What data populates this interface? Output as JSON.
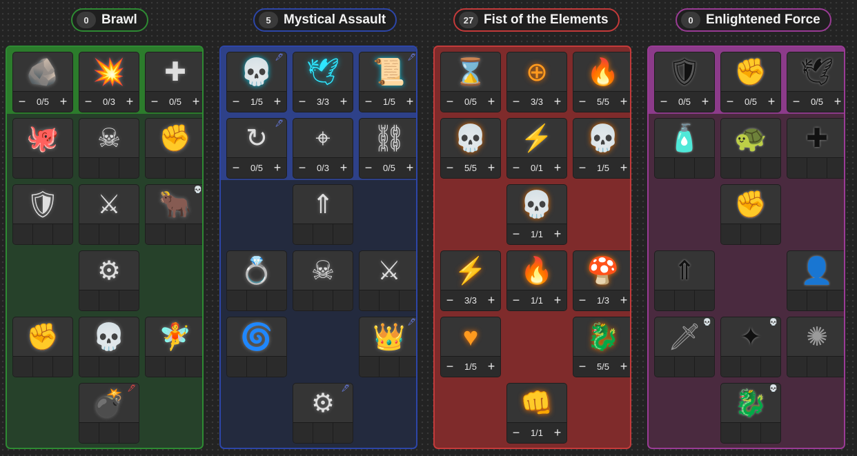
{
  "colors": {
    "brawl": "#2e8b33",
    "mystical": "#2d46a8",
    "fist": "#c43a3a",
    "enlightened": "#9a3b95"
  },
  "trees": [
    {
      "name": "Brawl",
      "points": "0",
      "skills": [
        {
          "icon": "marked-rock-icon",
          "glyph": "🪨",
          "style": "grey",
          "count": "0/5"
        },
        {
          "icon": "exploding-cannon-icon",
          "glyph": "💥",
          "style": "grey",
          "count": "0/3"
        },
        {
          "icon": "plus-crest-icon",
          "glyph": "✚",
          "style": "grey",
          "count": "0/5"
        },
        {
          "icon": "octopus-icon",
          "glyph": "🐙",
          "style": "grey"
        },
        {
          "icon": "cross-skull-icon",
          "glyph": "☠",
          "style": "grey"
        },
        {
          "icon": "swirl-fist-icon",
          "glyph": "✊",
          "style": "grey"
        },
        {
          "icon": "bandaged-shield-icon",
          "glyph": "🛡",
          "style": "grey"
        },
        {
          "icon": "scythe-burst-icon",
          "glyph": "⚔",
          "style": "grey"
        },
        {
          "icon": "horned-beast-icon",
          "glyph": "🐂",
          "style": "grey",
          "badge": "skull"
        },
        {
          "icon": "spiked-drill-icon",
          "glyph": "⚙",
          "style": "grey"
        },
        {
          "icon": "fist-burst-icon",
          "glyph": "✊",
          "style": "grey"
        },
        {
          "icon": "bone-skull-icon",
          "glyph": "💀",
          "style": "grey"
        },
        {
          "icon": "winged-fairy-icon",
          "glyph": "🧚",
          "style": "grey"
        },
        {
          "icon": "bomb-icon",
          "glyph": "💣",
          "style": "grey",
          "badge": "red-feather"
        }
      ]
    },
    {
      "name": "Mystical Assault",
      "points": "5",
      "skills": [
        {
          "icon": "triple-skull-icon",
          "glyph": "💀",
          "style": "cyan",
          "count": "1/5",
          "badge": "feather"
        },
        {
          "icon": "winged-gauntlet-icon",
          "glyph": "🕊",
          "style": "cyan",
          "count": "3/3"
        },
        {
          "icon": "skull-scroll-icon",
          "glyph": "📜",
          "style": "cyan",
          "count": "1/5",
          "badge": "feather"
        },
        {
          "icon": "arrow-fist-icon",
          "glyph": "↻",
          "style": "grey",
          "count": "0/5",
          "badge": "feather"
        },
        {
          "icon": "crosshair-icon",
          "glyph": "⌖",
          "style": "grey",
          "count": "0/3"
        },
        {
          "icon": "chain-ring-icon",
          "glyph": "⛓",
          "style": "grey",
          "count": "0/5"
        },
        {
          "icon": "rising-arrow-icon",
          "glyph": "⇑",
          "style": "grey"
        },
        {
          "icon": "ring-toss-icon",
          "glyph": "💍",
          "style": "grey"
        },
        {
          "icon": "skull-arrow-icon",
          "glyph": "☠",
          "style": "grey"
        },
        {
          "icon": "crossed-fists-icon",
          "glyph": "⚔",
          "style": "grey"
        },
        {
          "icon": "whirlwind-icon",
          "glyph": "🌀",
          "style": "grey"
        },
        {
          "icon": "crowned-skull-icon",
          "glyph": "👑",
          "style": "grey",
          "badge": "feather"
        },
        {
          "icon": "spinning-saw-icon",
          "glyph": "⚙",
          "style": "grey",
          "badge": "feather"
        }
      ]
    },
    {
      "name": "Fist of the Elements",
      "points": "27",
      "skills": [
        {
          "icon": "hourglass-icon",
          "glyph": "⌛",
          "style": "grey",
          "count": "0/5"
        },
        {
          "icon": "crosshair-fist-icon",
          "glyph": "⊕",
          "style": "orange",
          "count": "3/3"
        },
        {
          "icon": "flame-book-icon",
          "glyph": "🔥",
          "style": "orange",
          "count": "5/5"
        },
        {
          "icon": "lightning-skull-icon",
          "glyph": "💀",
          "style": "orange",
          "count": "5/5"
        },
        {
          "icon": "lightning-hand-icon",
          "glyph": "⚡",
          "style": "grey",
          "count": "0/1"
        },
        {
          "icon": "triple-skull-icon",
          "glyph": "💀",
          "style": "orange",
          "count": "1/5"
        },
        {
          "icon": "skull-blast-icon",
          "glyph": "💀",
          "style": "orange",
          "count": "1/1"
        },
        {
          "icon": "lightning-feather-icon",
          "glyph": "⚡",
          "style": "orange",
          "count": "3/3"
        },
        {
          "icon": "flaming-bar-icon",
          "glyph": "🔥",
          "style": "orange",
          "count": "1/1"
        },
        {
          "icon": "mushroom-skull-icon",
          "glyph": "🍄",
          "style": "orange",
          "count": "1/3"
        },
        {
          "icon": "heart-fist-icon",
          "glyph": "♥",
          "style": "orange",
          "count": "1/5"
        },
        {
          "icon": "fire-dragon-icon",
          "glyph": "🐉",
          "style": "orange",
          "count": "5/5"
        },
        {
          "icon": "flame-fist-icon",
          "glyph": "👊",
          "style": "orange",
          "count": "1/1"
        }
      ]
    },
    {
      "name": "Enlightened Force",
      "points": "0",
      "skills": [
        {
          "icon": "crest-shield-icon",
          "glyph": "🛡",
          "style": "black",
          "count": "0/5"
        },
        {
          "icon": "clenched-fist-icon",
          "glyph": "✊",
          "style": "black",
          "count": "0/5"
        },
        {
          "icon": "winged-fist-icon",
          "glyph": "🕊",
          "style": "black",
          "count": "0/5"
        },
        {
          "icon": "potion-bottle-icon",
          "glyph": "🧴",
          "style": "black"
        },
        {
          "icon": "turtle-shell-icon",
          "glyph": "🐢",
          "style": "black"
        },
        {
          "icon": "plus-fist-icon",
          "glyph": "✚",
          "style": "black"
        },
        {
          "icon": "swirl-fist-icon",
          "glyph": "✊",
          "style": "black"
        },
        {
          "icon": "rising-fist-icon",
          "glyph": "⇑",
          "style": "black"
        },
        {
          "icon": "woman-portrait-icon",
          "glyph": "👤",
          "style": "black"
        },
        {
          "icon": "sword-splash-icon",
          "glyph": "🗡",
          "style": "dark",
          "badge": "skull"
        },
        {
          "icon": "crystal-shards-icon",
          "glyph": "✦",
          "style": "black",
          "badge": "skull"
        },
        {
          "icon": "light-burst-icon",
          "glyph": "✺",
          "style": "dark"
        },
        {
          "icon": "black-dragon-icon",
          "glyph": "🐉",
          "style": "black",
          "badge": "skull"
        }
      ]
    }
  ]
}
